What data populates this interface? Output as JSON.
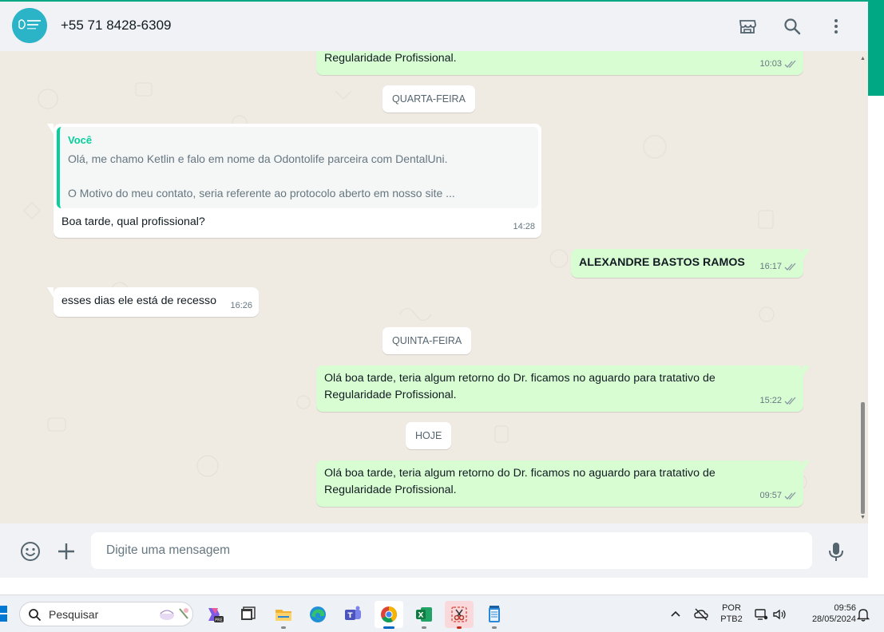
{
  "header": {
    "contact_name": "+55 71 8428-6309"
  },
  "chat": {
    "messages": [
      {
        "text_line1": "Regularidade Profissional.",
        "time": "10:03"
      },
      {
        "date": "QUARTA-FEIRA"
      },
      {
        "quote_author": "Você",
        "quote_line1": "Olá, me chamo Ketlin e falo em nome da Odontolife parceira com DentalUni.",
        "quote_line2": "O Motivo do meu contato, seria referente ao protocolo aberto em nosso site ...",
        "text": "Boa tarde, qual profissional?",
        "time": "14:28"
      },
      {
        "text": "ALEXANDRE BASTOS RAMOS",
        "time": "16:17"
      },
      {
        "text": "esses dias ele está de recesso",
        "time": "16:26"
      },
      {
        "date": "QUINTA-FEIRA"
      },
      {
        "text_line1": "Olá boa tarde, teria algum retorno do Dr. ficamos no aguardo para tratativo de",
        "text_line2": "Regularidade Profissional.",
        "time": "15:22"
      },
      {
        "date": "HOJE"
      },
      {
        "text_line1": "Olá boa tarde, teria algum retorno do Dr. ficamos no aguardo para tratativo de",
        "text_line2": "Regularidade Profissional.",
        "time": "09:57"
      }
    ]
  },
  "composer": {
    "placeholder": "Digite uma mensagem"
  },
  "taskbar": {
    "search_label": "Pesquisar",
    "lang_line1": "POR",
    "lang_line2": "PTB2",
    "clock_time": "09:56",
    "clock_date": "28/05/2024"
  },
  "colors": {
    "outgoing_bubble": "#d9fdd3",
    "incoming_bubble": "#ffffff",
    "chat_background": "#efeae2",
    "accent": "#00a884",
    "quote_author": "#06cf9c",
    "tick_read": "#8696a0"
  }
}
